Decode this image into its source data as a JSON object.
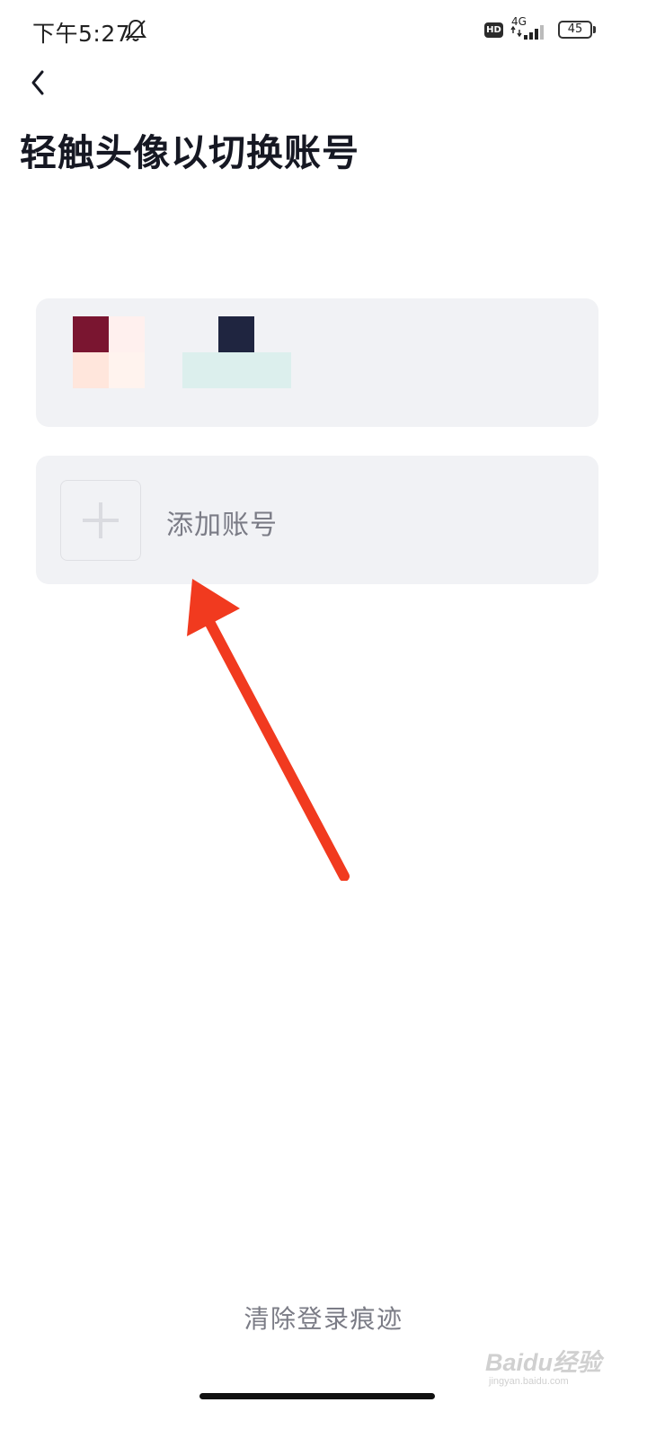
{
  "status_bar": {
    "time": "下午5:27",
    "hd_badge": "HD",
    "network": "4G",
    "battery": "45",
    "icons": [
      "bell-muted-icon",
      "signal-icon",
      "battery-icon"
    ]
  },
  "header": {
    "back_icon": "chevron-left-icon",
    "title": "轻触头像以切换账号"
  },
  "accounts": {
    "existing_account": "pixelated avatar and name",
    "add_account_label": "添加账号",
    "add_icon": "plus-icon"
  },
  "footer": {
    "clear_traces_label": "清除登录痕迹"
  },
  "annotation": {
    "arrow_color": "#f13a1f"
  },
  "watermark": {
    "main": "Baidu经验",
    "sub": "jingyan.baidu.com"
  },
  "colors": {
    "title": "#161823",
    "card_background": "#f1f2f5",
    "secondary_text": "#7b7c86"
  }
}
